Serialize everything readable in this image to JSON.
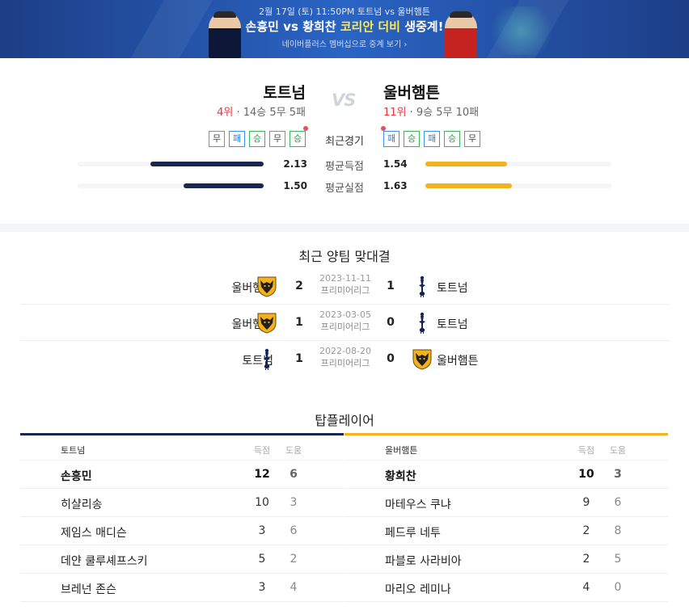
{
  "banner": {
    "date_line": "2월 17일 (토) 11:50PM 토트넘 vs 울버햄튼",
    "headline_a": "손흥민 vs 황희찬 ",
    "headline_b": "코리안 더비",
    "headline_c": " 생중계!",
    "sub": "네이버플러스 멤버십으로 중계 보기 ›"
  },
  "match": {
    "vs": "VS",
    "home": {
      "name": "토트넘",
      "rank": "4위",
      "record": " · 14승 5무 5패",
      "form": [
        {
          "r": "무",
          "t": "d"
        },
        {
          "r": "패",
          "t": "l"
        },
        {
          "r": "승",
          "t": "w"
        },
        {
          "r": "무",
          "t": "d"
        },
        {
          "r": "승",
          "t": "w"
        }
      ]
    },
    "away": {
      "name": "울버햄튼",
      "rank": "11위",
      "record": " · 9승 5무 10패",
      "form": [
        {
          "r": "패",
          "t": "l"
        },
        {
          "r": "승",
          "t": "w"
        },
        {
          "r": "패",
          "t": "l"
        },
        {
          "r": "승",
          "t": "w"
        },
        {
          "r": "무",
          "t": "d"
        }
      ]
    },
    "form_label": "최근경기",
    "stats": [
      {
        "label": "평균득점",
        "home": "2.13",
        "away": "1.54",
        "home_val": 2.13,
        "away_val": 1.54
      },
      {
        "label": "평균실점",
        "home": "1.50",
        "away": "1.63",
        "home_val": 1.5,
        "away_val": 1.63
      }
    ],
    "stat_scale_max": 3.5
  },
  "h2h": {
    "title": "최근 양팀 맞대결",
    "rows": [
      {
        "home": "울버햄튼",
        "home_crest": "wolves-crest",
        "home_score": "2",
        "date": "2023-11-11",
        "league": "프리미어리그",
        "away_score": "1",
        "away": "토트넘",
        "away_crest": "spurs-crest"
      },
      {
        "home": "울버햄튼",
        "home_crest": "wolves-crest",
        "home_score": "1",
        "date": "2023-03-05",
        "league": "프리미어리그",
        "away_score": "0",
        "away": "토트넘",
        "away_crest": "spurs-crest"
      },
      {
        "home": "토트넘",
        "home_crest": "spurs-crest",
        "home_score": "1",
        "date": "2022-08-20",
        "league": "프리미어리그",
        "away_score": "0",
        "away": "울버햄튼",
        "away_crest": "wolves-crest"
      }
    ]
  },
  "top_players": {
    "title": "탑플레이어",
    "col_goals": "득점",
    "col_assists": "도움",
    "home": {
      "team": "토트넘",
      "players": [
        {
          "name": "손흥민",
          "goals": "12",
          "assists": "6"
        },
        {
          "name": "히샬리송",
          "goals": "10",
          "assists": "3"
        },
        {
          "name": "제임스 매디슨",
          "goals": "3",
          "assists": "6"
        },
        {
          "name": "데얀 쿨루셰프스키",
          "goals": "5",
          "assists": "2"
        },
        {
          "name": "브레넌 존슨",
          "goals": "3",
          "assists": "4"
        }
      ]
    },
    "away": {
      "team": "울버햄튼",
      "players": [
        {
          "name": "황희찬",
          "goals": "10",
          "assists": "3"
        },
        {
          "name": "마테우스 쿠냐",
          "goals": "9",
          "assists": "6"
        },
        {
          "name": "페드루 네투",
          "goals": "2",
          "assists": "8"
        },
        {
          "name": "파블로 사라비아",
          "goals": "2",
          "assists": "5"
        },
        {
          "name": "마리오 레미나",
          "goals": "4",
          "assists": "0"
        }
      ]
    }
  },
  "colors": {
    "spurs_navy": "#1a2550",
    "wolves_gold": "#f3b11a",
    "rank_red": "#e8363d",
    "win_green": "#2f9c4c",
    "loss_blue": "#2d7de0"
  }
}
